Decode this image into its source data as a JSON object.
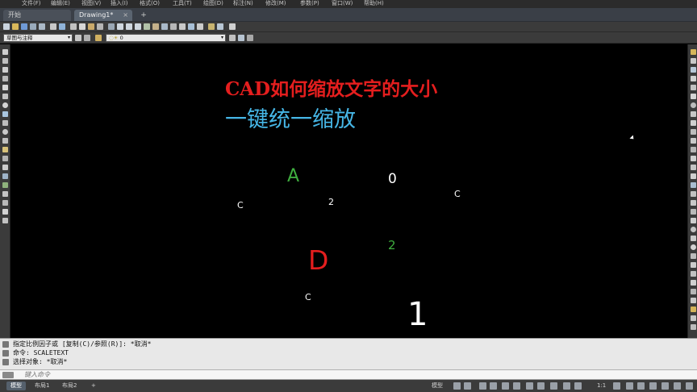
{
  "menu": [
    "文件(F)",
    "编辑(E)",
    "视图(V)",
    "插入(I)",
    "格式(O)",
    "工具(T)",
    "绘图(D)",
    "标注(N)",
    "修改(M)",
    "参数(P)",
    "窗口(W)",
    "帮助(H)"
  ],
  "tabs": {
    "start": "开始",
    "drawing": "Drawing1*",
    "close": "×",
    "add": "+"
  },
  "toolbar": {
    "workspace": "草图与注释",
    "layer": "0",
    "arrow": "▾"
  },
  "canvas": {
    "title_line1": "CAD如何缩放文字的大小",
    "title_line2": "一键统一缩放",
    "texts": [
      {
        "id": "A",
        "text": "A",
        "color": "#3fae3f"
      },
      {
        "id": "zero",
        "text": "0",
        "color": "#ffffff"
      },
      {
        "id": "c1",
        "text": "C",
        "color": "#ffffff"
      },
      {
        "id": "c2",
        "text": "C",
        "color": "#ffffff"
      },
      {
        "id": "two-white",
        "text": "2",
        "color": "#ffffff"
      },
      {
        "id": "two-green",
        "text": "2",
        "color": "#3fae3f"
      },
      {
        "id": "D",
        "text": "D",
        "color": "#e41e1e"
      },
      {
        "id": "c3",
        "text": "C",
        "color": "#ffffff"
      },
      {
        "id": "one",
        "text": "1",
        "color": "#ffffff"
      }
    ]
  },
  "command": {
    "history": [
      "指定比例因子或 [复制(C)/参照(R)]: *取消*",
      "命令: SCALETEXT",
      "选择对象: *取消*"
    ],
    "prompt": "键入命令"
  },
  "status": {
    "tab_model": "模型",
    "tab_layout1": "布局1",
    "tab_layout2": "布局2",
    "add": "+",
    "mode": "模型",
    "scale": "1:1"
  },
  "colors": {
    "canvas_bg": "#000000",
    "toolbar_bg": "#3b3b3b",
    "title_red": "#e41e1e",
    "title_blue": "#46b6e6"
  }
}
